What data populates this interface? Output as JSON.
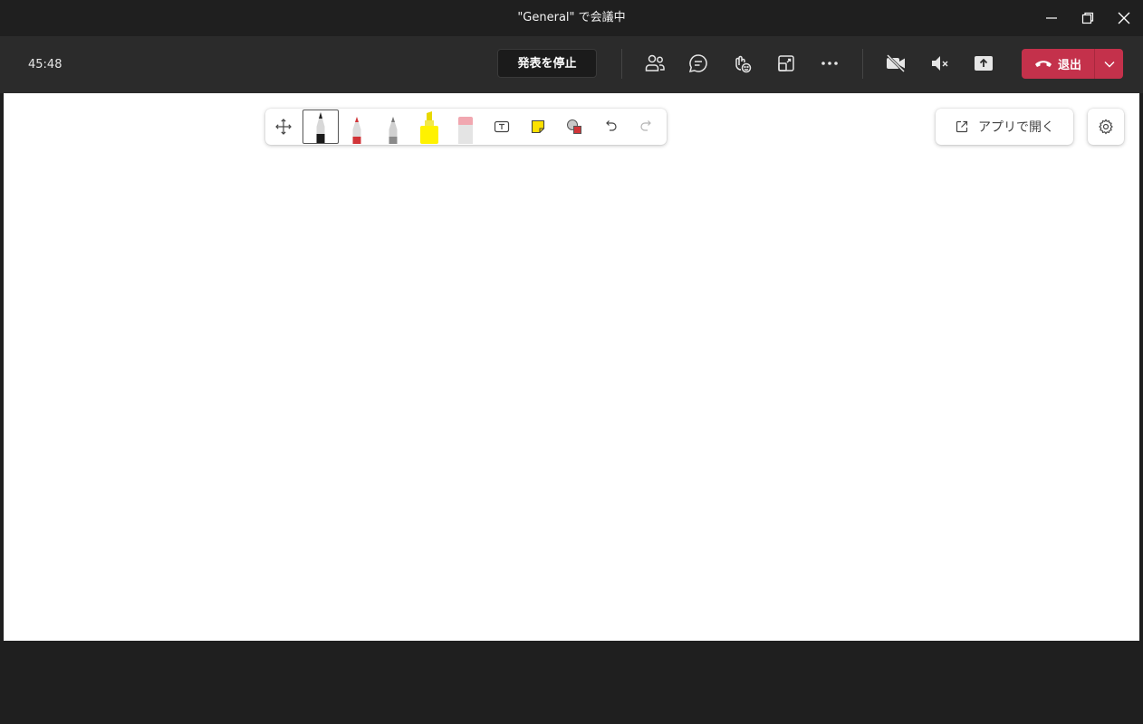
{
  "window": {
    "title": "\"General\" で会議中",
    "icons": [
      "minimize-icon",
      "restore-icon",
      "close-icon"
    ]
  },
  "meeting": {
    "timer": "45:48",
    "stop_presenting_label": "発表を停止",
    "leave_label": "退出",
    "leave_color": "#c4314b",
    "icons": [
      "participants-icon",
      "chat-icon",
      "reactions-icon",
      "rooms-icon",
      "more-icon",
      "camera-off-icon",
      "mic-muted-icon",
      "share-icon",
      "hangup-icon",
      "chevron-down-icon"
    ]
  },
  "whiteboard": {
    "tools": [
      "move-icon",
      "black-pen-icon",
      "red-pen-icon",
      "gray-pencil-icon",
      "yellow-highlighter-icon",
      "eraser-icon",
      "text-icon",
      "sticky-note-icon",
      "shape-icon",
      "undo-icon",
      "redo-icon"
    ],
    "selected_tool": "black-pen-icon",
    "open_in_app_label": "アプリで開く",
    "settings_icon": "gear-icon"
  }
}
